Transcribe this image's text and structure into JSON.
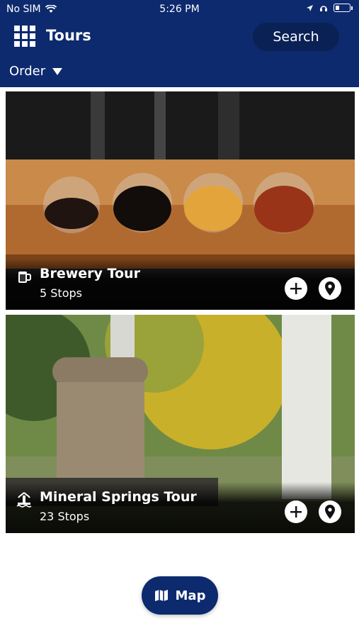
{
  "status_bar": {
    "carrier": "No SIM",
    "time": "5:26 PM"
  },
  "header": {
    "title": "Tours",
    "search_label": "Search",
    "order_label": "Order",
    "background_color": "#0d2a6e"
  },
  "tours": [
    {
      "title": "Brewery Tour",
      "stops": "5 Stops",
      "icon": "beer-mug-icon"
    },
    {
      "title": "Mineral Springs Tour",
      "stops": "23 Stops",
      "icon": "fountain-icon"
    }
  ],
  "map_button": {
    "label": "Map",
    "icon": "map-icon"
  }
}
